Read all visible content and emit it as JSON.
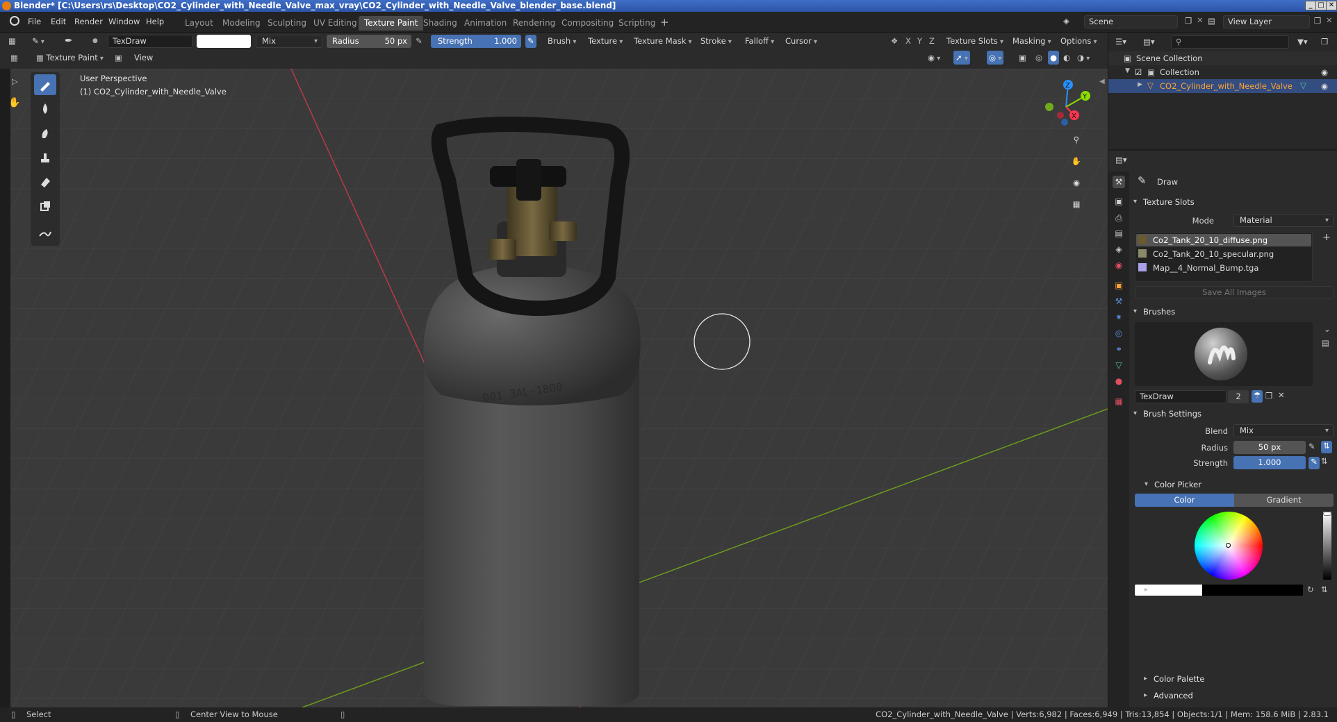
{
  "title": "Blender* [C:\\Users\\rs\\Desktop\\CO2_Cylinder_with_Needle_Valve_max_vray\\CO2_Cylinder_with_Needle_Valve_blender_base.blend]",
  "menus": [
    "File",
    "Edit",
    "Render",
    "Window",
    "Help"
  ],
  "workspaces": [
    "Layout",
    "Modeling",
    "Sculpting",
    "UV Editing",
    "Texture Paint",
    "Shading",
    "Animation",
    "Rendering",
    "Compositing",
    "Scripting"
  ],
  "active_workspace": "Texture Paint",
  "scene": "Scene",
  "view_layer": "View Layer",
  "tool_header": {
    "brush_name": "TexDraw",
    "blend": "Mix",
    "radius_label": "Radius",
    "radius_value": "50 px",
    "strength_label": "Strength",
    "strength_value": "1.000",
    "strength_fraction": 1.0,
    "menus": [
      "Brush",
      "Texture",
      "Texture Mask",
      "Stroke",
      "Falloff",
      "Cursor"
    ],
    "axes": [
      "X",
      "Y",
      "Z"
    ],
    "right_menus": [
      "Texture Slots",
      "Masking",
      "Options"
    ]
  },
  "mode_header": {
    "mode": "Texture Paint",
    "view": "View"
  },
  "viewport": {
    "perspective": "User Perspective",
    "object": "(1) CO2_Cylinder_with_Needle_Valve",
    "tank_text": "D01 3AL-1800"
  },
  "gizmo": {
    "x": "X",
    "y": "Y",
    "z": "Z"
  },
  "outliner": {
    "scene_collection": "Scene Collection",
    "collection": "Collection",
    "object": "CO2_Cylinder_with_Needle_Valve"
  },
  "props": {
    "tool_name": "Draw",
    "texture_slots": {
      "title": "Texture Slots",
      "mode_label": "Mode",
      "mode_value": "Material",
      "slots": [
        "Co2_Tank_20_10_diffuse.png",
        "Co2_Tank_20_10_specular.png",
        "Map__4_Normal_Bump.tga"
      ],
      "save_all": "Save All Images"
    },
    "brushes": {
      "title": "Brushes",
      "brush_name": "TexDraw",
      "users": "2"
    },
    "brush_settings": {
      "title": "Brush Settings",
      "blend_label": "Blend",
      "blend_value": "Mix",
      "radius_label": "Radius",
      "radius_value": "50 px",
      "strength_label": "Strength",
      "strength_value": "1.000"
    },
    "color_picker": {
      "title": "Color Picker",
      "tab_color": "Color",
      "tab_gradient": "Gradient",
      "value_fraction": 1.0
    },
    "color_palette": "Color Palette",
    "advanced": "Advanced"
  },
  "status": {
    "select": "Select",
    "center_view": "Center View to Mouse",
    "stats": "CO2_Cylinder_with_Needle_Valve | Verts:6,982 | Faces:6,949 | Tris:13,854 | Objects:1/1 | Mem: 158.6 MiB | 2.83.1"
  },
  "colors": {
    "accent": "#4772b3",
    "title_bar": "#2b54a8",
    "selected_text": "#ffa236",
    "x_axis": "#ff3352",
    "y_axis": "#8bdc00",
    "z_axis": "#2890ff"
  },
  "icons": [
    "blender-logo",
    "brush-icon",
    "fill-icon",
    "smear-icon",
    "clone-icon",
    "soften-icon",
    "mask-icon",
    "annotate-icon",
    "zoom-icon",
    "hand-icon",
    "camera-icon",
    "grid-icon",
    "eye-icon",
    "plus-icon",
    "close-icon"
  ]
}
